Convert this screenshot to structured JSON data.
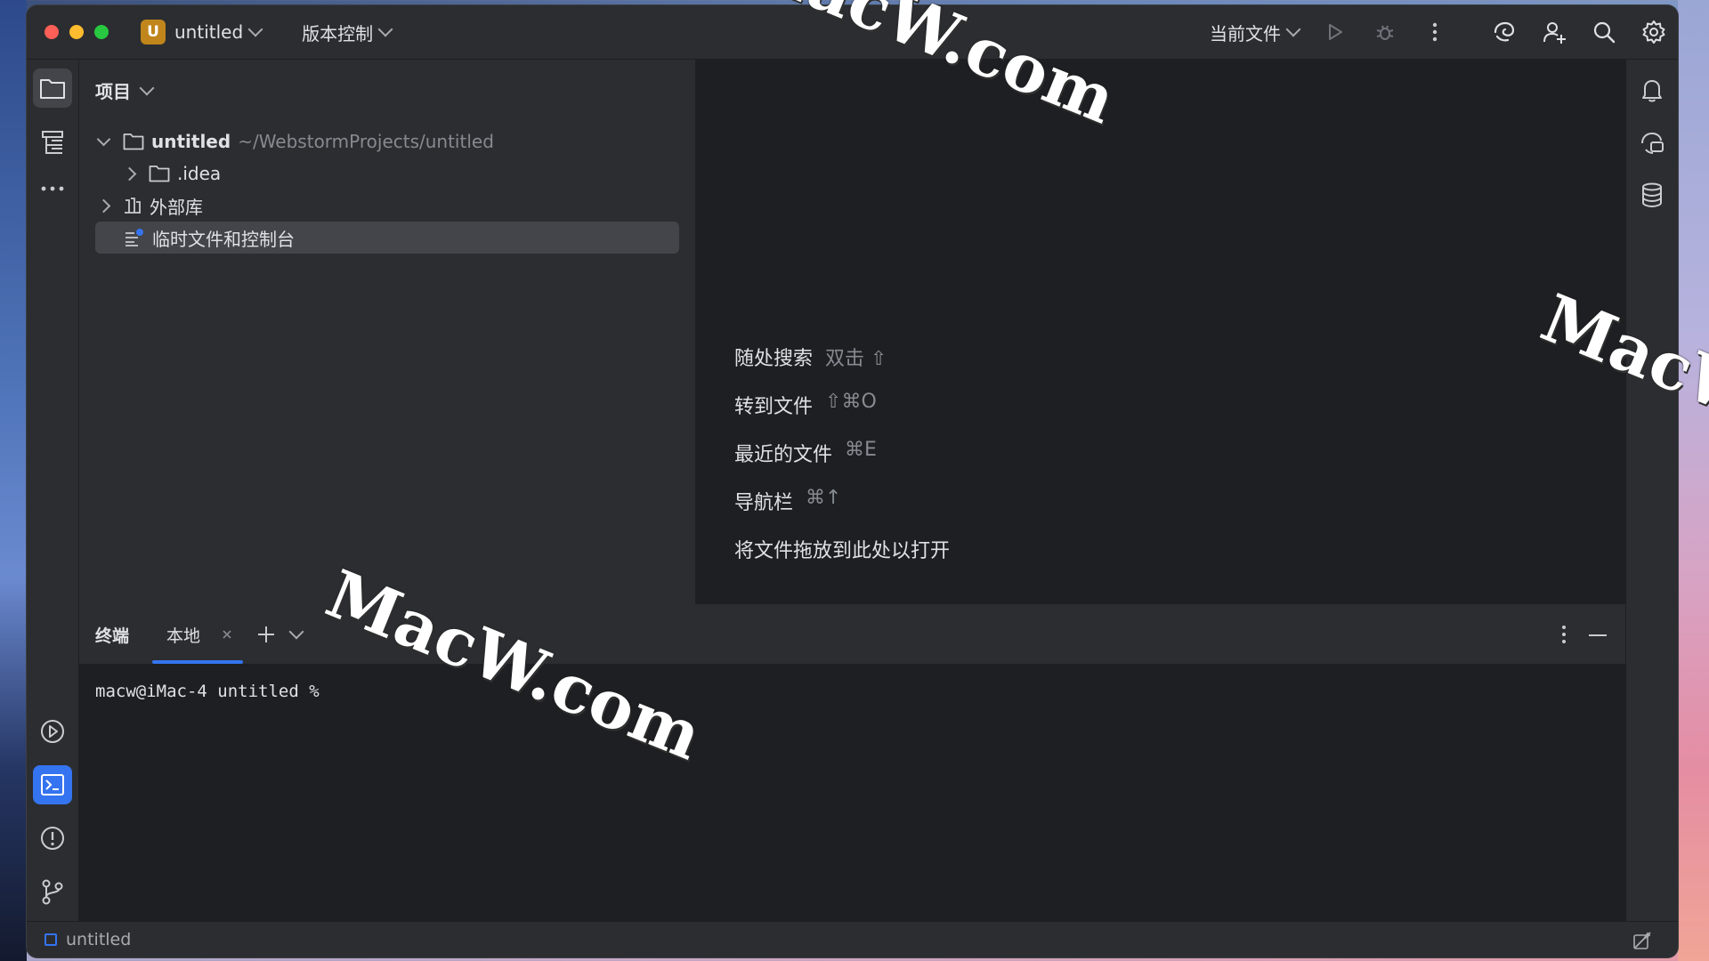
{
  "window": {
    "project_badge": "U",
    "project_name": "untitled",
    "vcs_menu": "版本控制",
    "run_config": "当前文件"
  },
  "project_panel": {
    "title": "项目",
    "tree": [
      {
        "label": "untitled",
        "path": "~/WebstormProjects/untitled",
        "expanded": true,
        "icon": "folder-icon"
      },
      {
        "label": ".idea",
        "expanded": false,
        "icon": "folder-icon"
      },
      {
        "label": "外部库",
        "expanded": false,
        "icon": "library-icon"
      },
      {
        "label": "临时文件和控制台",
        "icon": "scratches-icon",
        "selected": true
      }
    ]
  },
  "editor_hints": [
    {
      "label": "随处搜索",
      "shortcut": "双击 ⇧"
    },
    {
      "label": "转到文件",
      "shortcut": "⇧⌘O"
    },
    {
      "label": "最近的文件",
      "shortcut": "⌘E"
    },
    {
      "label": "导航栏",
      "shortcut": "⌘↑"
    },
    {
      "label": "将文件拖放到此处以打开",
      "shortcut": ""
    }
  ],
  "terminal": {
    "title": "终端",
    "tab_label": "本地",
    "prompt": "macw@iMac-4 untitled %"
  },
  "statusbar": {
    "project": "untitled"
  },
  "watermark": {
    "text": "MacW.com"
  },
  "colors": {
    "accent": "#3574f0",
    "badge": "#c0861b",
    "panel_bg": "#2b2d30",
    "editor_bg": "#1e1f22"
  }
}
